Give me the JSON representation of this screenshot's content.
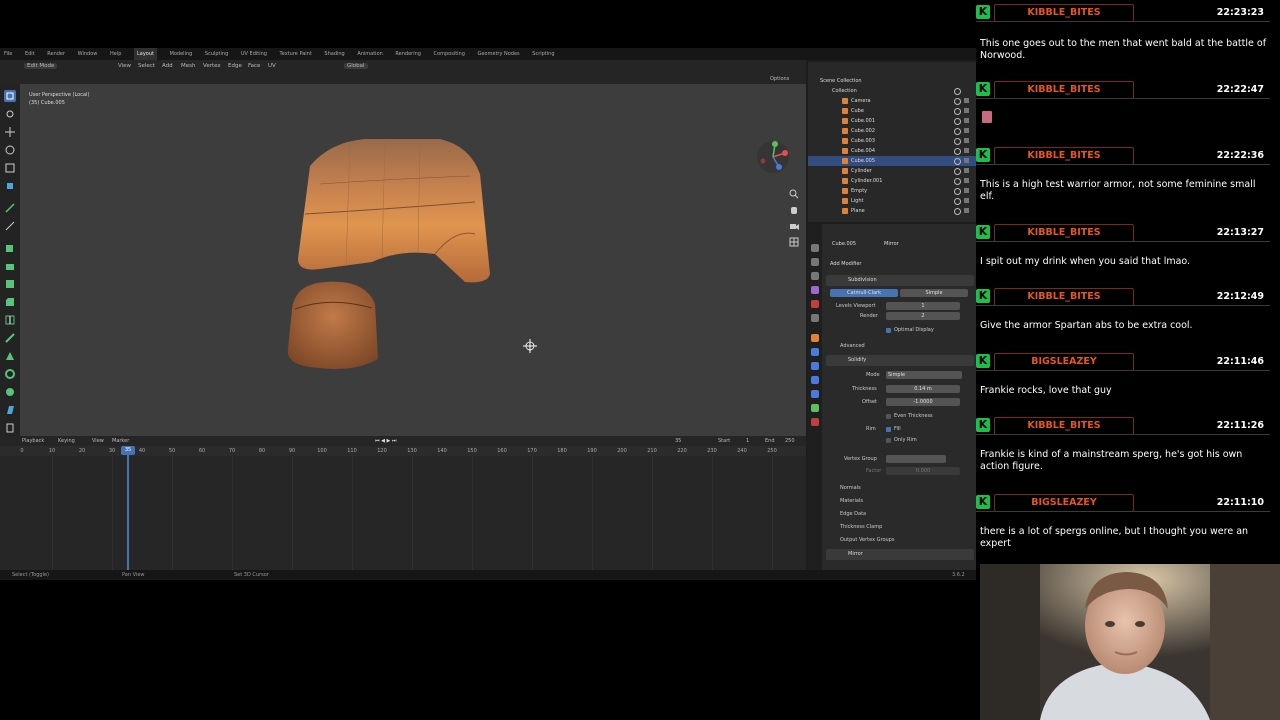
{
  "blender": {
    "topbar": {
      "menus": [
        "File",
        "Edit",
        "Render",
        "Window",
        "Help"
      ],
      "workspaces": [
        "Layout",
        "Modeling",
        "Sculpting",
        "UV Editing",
        "Texture Paint",
        "Shading",
        "Animation",
        "Rendering",
        "Compositing",
        "Geometry Nodes",
        "Scripting"
      ],
      "active_workspace": "Layout"
    },
    "header": {
      "mode": "Edit Mode",
      "menus": [
        "View",
        "Select",
        "Add",
        "Mesh",
        "Vertex",
        "Edge",
        "Face",
        "UV"
      ],
      "orientation": "Global",
      "options": "Options"
    },
    "viewport": {
      "view_name": "User Perspective (Local)",
      "object_label": "(35) Cube.005",
      "mesh_color": "#c8824e"
    },
    "timeline": {
      "menus": [
        "Playback",
        "Keying",
        "View",
        "Marker"
      ],
      "current_frame": "35",
      "start_label": "Start",
      "start_value": "1",
      "end_label": "End",
      "end_value": "250",
      "ruler": [
        "0",
        "10",
        "20",
        "30",
        "35",
        "40",
        "50",
        "60",
        "70",
        "80",
        "90",
        "100",
        "110",
        "120",
        "130",
        "140",
        "150",
        "160",
        "170",
        "180",
        "190",
        "200",
        "210",
        "220",
        "230",
        "240",
        "250"
      ]
    },
    "status": {
      "select": "Select (Toggle)",
      "pan": "Pan View",
      "cursor": "Set 3D Cursor",
      "version": "3.6.2"
    },
    "outliner": {
      "scene_collection": "Scene Collection",
      "collection": "Collection",
      "items": [
        "Camera",
        "Cube",
        "Cube.001",
        "Cube.002",
        "Cube.003",
        "Cube.004",
        "Cube.005",
        "Cylinder",
        "Cylinder.001",
        "Empty",
        "Light",
        "Plane"
      ],
      "selected": "Cube.005"
    },
    "properties": {
      "breadcrumb_object": "Cube.005",
      "breadcrumb_modifier": "Mirror",
      "add_modifier": "Add Modifier",
      "subdivision": {
        "name": "Subdivision",
        "tab_a": "Catmull-Clark",
        "tab_b": "Simple",
        "levels_label": "Levels Viewport",
        "levels_value": "1",
        "render_label": "Render",
        "render_value": "2",
        "optimal": "Optimal Display",
        "advanced": "Advanced"
      },
      "solidify": {
        "name": "Solidify",
        "mode_label": "Mode",
        "mode_value": "Simple",
        "thickness_label": "Thickness",
        "thickness_value": "0.14 m",
        "offset_label": "Offset",
        "offset_value": "-1.0000",
        "even_thickness": "Even Thickness",
        "rim_label": "Rim",
        "fill": "Fill",
        "only_rim": "Only Rim",
        "vertex_group": "Vertex Group",
        "factor_label": "Factor",
        "factor_value": "0.000",
        "sections": [
          "Normals",
          "Materials",
          "Edge Data",
          "Thickness Clamp",
          "Output Vertex Groups"
        ]
      },
      "mirror": {
        "name": "Mirror"
      }
    }
  },
  "chat": {
    "platform_letter": "K",
    "accent": "#1dbf4b",
    "messages": [
      {
        "user": "KIBBLE_BITES",
        "time": "22:23:23",
        "text": "This one goes out to the men that went bald at the battle of Norwood."
      },
      {
        "user": "KIBBLE_BITES",
        "time": "22:22:47",
        "text": ""
      },
      {
        "user": "KIBBLE_BITES",
        "time": "22:22:36",
        "text": "This is a high test warrior armor, not some feminine small elf."
      },
      {
        "user": "KIBBLE_BITES",
        "time": "22:13:27",
        "text": "I spit out my drink when you said that lmao."
      },
      {
        "user": "KIBBLE_BITES",
        "time": "22:12:49",
        "text": "Give the armor Spartan abs to be extra cool."
      },
      {
        "user": "BIGSLEAZEY",
        "time": "22:11:46",
        "text": "Frankie rocks, love that guy"
      },
      {
        "user": "KIBBLE_BITES",
        "time": "22:11:26",
        "text": "Frankie is kind of a mainstream sperg, he's got his own action figure."
      },
      {
        "user": "BIGSLEAZEY",
        "time": "22:11:10",
        "text": "there is a lot of spergs online, but I thought you were an expert"
      }
    ]
  }
}
